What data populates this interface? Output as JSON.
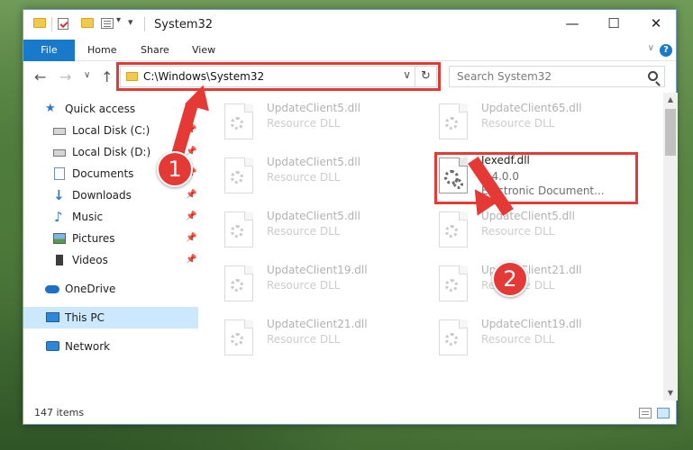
{
  "window": {
    "title": "System32",
    "minimize": "—",
    "maximize": "☐",
    "close": "✕"
  },
  "ribbon": {
    "tabs": [
      "File",
      "Home",
      "Share",
      "View"
    ],
    "collapse": "∨",
    "help": "?"
  },
  "nav": {
    "back": "←",
    "forward": "→",
    "recent": "∨",
    "up": "↑",
    "address": "C:\\Windows\\System32",
    "address_dropdown": "∨",
    "refresh": "↻",
    "search_placeholder": "Search System32"
  },
  "sidebar": {
    "items": [
      {
        "label": "Quick access",
        "icon": "star-icon",
        "pinned": false
      },
      {
        "label": "Local Disk (C:)",
        "icon": "drive-icon",
        "pinned": true
      },
      {
        "label": "Local Disk (D:)",
        "icon": "drive-icon",
        "pinned": true
      },
      {
        "label": "Documents",
        "icon": "documents-icon",
        "pinned": true
      },
      {
        "label": "Downloads",
        "icon": "download-icon",
        "pinned": true
      },
      {
        "label": "Music",
        "icon": "music-icon",
        "pinned": true
      },
      {
        "label": "Pictures",
        "icon": "pictures-icon",
        "pinned": true
      },
      {
        "label": "Videos",
        "icon": "videos-icon",
        "pinned": true
      },
      {
        "label": "OneDrive",
        "icon": "cloud-icon",
        "pinned": false
      },
      {
        "label": "This PC",
        "icon": "computer-icon",
        "pinned": false,
        "selected": true
      },
      {
        "label": "Network",
        "icon": "network-icon",
        "pinned": false
      }
    ],
    "pin_glyph": "📌"
  },
  "files": {
    "left": [
      {
        "name": "UpdateClient5.dll",
        "type": "Resource DLL"
      },
      {
        "name": "UpdateClient5.dll",
        "type": "Resource DLL"
      },
      {
        "name": "UpdateClient5.dll",
        "type": "Resource DLL"
      },
      {
        "name": "UpdateClient19.dll",
        "type": "Resource DLL"
      },
      {
        "name": "UpdateClient21.dll",
        "type": "Resource DLL"
      }
    ],
    "right": [
      {
        "name": "UpdateClient65.dll",
        "type": "Resource DLL"
      },
      {
        "name": "UpdateClient5.dll",
        "type": "Resource DLL"
      },
      {
        "name": "UpdateClient21.dll",
        "type": "Resource DLL"
      },
      {
        "name": "UpdateClient19.dll",
        "type": "Resource DLL"
      }
    ],
    "highlighted": {
      "name": "Iexedf.dll",
      "version": "7.4.0.0",
      "description": "Electronic Document..."
    }
  },
  "status": {
    "count": "147 items"
  },
  "callouts": {
    "one": "1",
    "two": "2"
  },
  "colors": {
    "accent": "#1979ca",
    "highlight_red": "#e53935",
    "selected_bg": "#cce8ff"
  }
}
